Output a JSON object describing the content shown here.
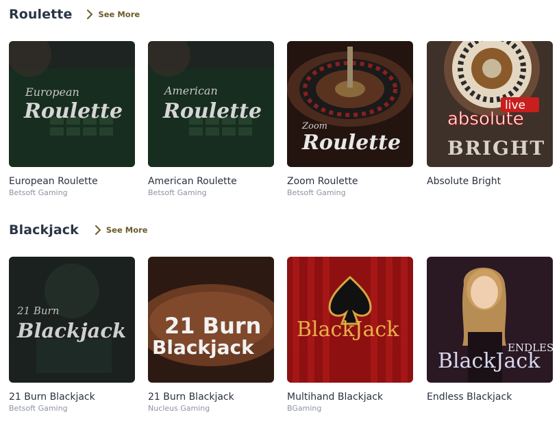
{
  "sections": [
    {
      "title": "Roulette",
      "see_more": "See More",
      "games": [
        {
          "name": "European Roulette",
          "provider": "Betsoft Gaming",
          "art_top": "European",
          "art_main": "Roulette",
          "bg": "#1f2623"
        },
        {
          "name": "American Roulette",
          "provider": "Betsoft Gaming",
          "art_top": "American",
          "art_main": "Roulette",
          "bg": "#1f2623"
        },
        {
          "name": "Zoom Roulette",
          "provider": "Betsoft Gaming",
          "art_top": "Zoom",
          "art_main": "Roulette",
          "bg": "#2a1b16"
        },
        {
          "name": "Absolute Bright",
          "provider": "",
          "art_top": "live",
          "art_main": "absolute",
          "art_sub": "BRIGHT",
          "bg": "#4a3a30"
        }
      ]
    },
    {
      "title": "Blackjack",
      "see_more": "See More",
      "games": [
        {
          "name": "21 Burn Blackjack",
          "provider": "Betsoft Gaming",
          "art_top": "21 Burn",
          "art_main": "Blackjack",
          "bg": "#1c2320"
        },
        {
          "name": "21 Burn Blackjack",
          "provider": "Nucleus Gaming",
          "art_top": "21 Burn",
          "art_main": "Blackjack",
          "bg": "#3a2418"
        },
        {
          "name": "Multihand Blackjack",
          "provider": "BGaming",
          "art_top": "",
          "art_main": "BlackJack",
          "bg": "#9a1212"
        },
        {
          "name": "Endless Blackjack",
          "provider": "",
          "art_top": "ENDLESS",
          "art_main": "BlackJack",
          "bg": "#2c1a24"
        }
      ]
    }
  ],
  "icons": {
    "see_more": "chevron-right-icon"
  },
  "colors": {
    "accent": "#6b5a2a",
    "title": "#2a3547",
    "provider": "#8c93a0"
  }
}
